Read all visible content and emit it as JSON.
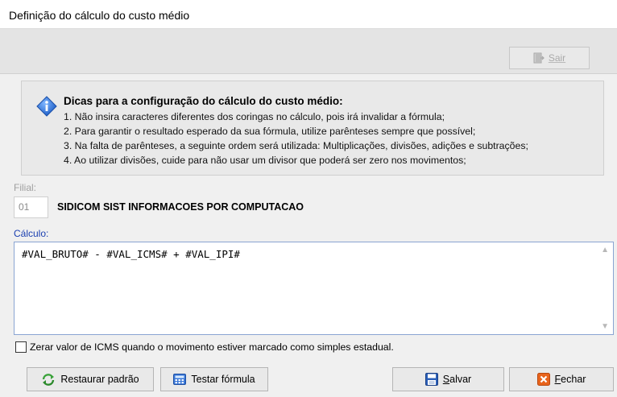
{
  "window": {
    "title": "Definição do cálculo do custo médio"
  },
  "toolbar": {
    "exit_label": "Sair"
  },
  "tips": {
    "title": "Dicas para a configuração do cálculo do custo médio:",
    "lines": [
      "1. Não insira caracteres diferentes dos coringas no cálculo, pois irá invalidar a fórmula;",
      "2. Para garantir o resultado esperado da sua fórmula, utilize parênteses sempre que possível;",
      "3. Na falta de parênteses, a seguinte ordem será utilizada: Multiplicações, divisões, adições e subtrações;",
      "4. Ao utilizar divisões, cuide para não usar um divisor que poderá ser zero nos movimentos;"
    ]
  },
  "filial": {
    "label": "Filial:",
    "code": "01",
    "name": "SIDICOM SIST INFORMACOES POR COMPUTACAO"
  },
  "calculo": {
    "label": "Cálculo:",
    "value": "#VAL_BRUTO# - #VAL_ICMS# + #VAL_IPI#"
  },
  "checkbox": {
    "label": "Zerar valor de ICMS quando o movimento estiver marcado como simples estadual.",
    "checked": false
  },
  "buttons": {
    "restore": "Restaurar padrão",
    "test": "Testar fórmula",
    "save_first": "S",
    "save_rest": "alvar",
    "close_first": "F",
    "close_rest": "echar"
  },
  "colors": {
    "accent_label": "#1a3fb0",
    "disabled_text": "#a0a0a0",
    "info_icon": "#2a6fd6",
    "save_icon": "#2b5fb8",
    "close_icon": "#e8641c"
  }
}
